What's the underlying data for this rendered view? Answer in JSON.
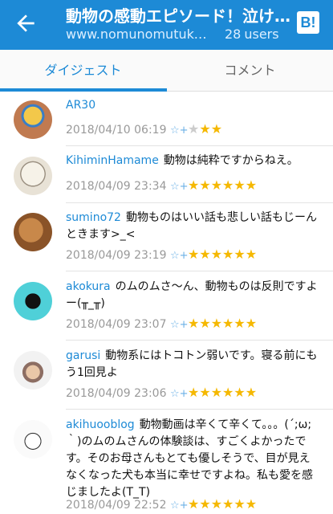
{
  "appbar": {
    "title": "動物の感動エピソード！泣ける話・犬・猫",
    "url": "www.nomunomutukai.com",
    "users_count": "28",
    "users_label": "users",
    "hatena_button": "B!"
  },
  "tabs": [
    {
      "label": "ダイジェスト",
      "active": true
    },
    {
      "label": "コメント",
      "active": false
    }
  ],
  "add_star_label": "☆+",
  "comments": [
    {
      "user": "AR30",
      "text": "",
      "date": "2018/04/10 06:19",
      "stars": 3,
      "star_display": "gray-one"
    },
    {
      "user": "KihiminHamame",
      "text": "動物は純粋ですからねえ。",
      "date": "2018/04/09 23:34",
      "stars": 6
    },
    {
      "user": "sumino72",
      "text": "動物ものはいい話も悲しい話もじーんときます>_<",
      "date": "2018/04/09 23:19",
      "stars": 6
    },
    {
      "user": "akokura",
      "text": "のムのムさ〜ん、動物ものは反則ですよー(╥_╥)",
      "date": "2018/04/09 23:07",
      "stars": 6
    },
    {
      "user": "garusi",
      "text": "動物系にはトコトン弱いです。寝る前にもう1回見よ",
      "date": "2018/04/09 23:06",
      "stars": 6
    },
    {
      "user": "akihuooblog",
      "text": "動物動画は辛くて辛くて。。。(´;ω;｀)のムのムさんの体験談は、すごくよかったです。そのお母さんもとても優しそうで、目が見えなくなった犬も本当に幸せですよね。私も愛を感じましたよ(T_T)",
      "date": "2018/04/09 22:52",
      "stars": 6
    }
  ],
  "colors": {
    "accent": "#1d8ad6",
    "star": "#f5b800",
    "meta": "#999999"
  }
}
